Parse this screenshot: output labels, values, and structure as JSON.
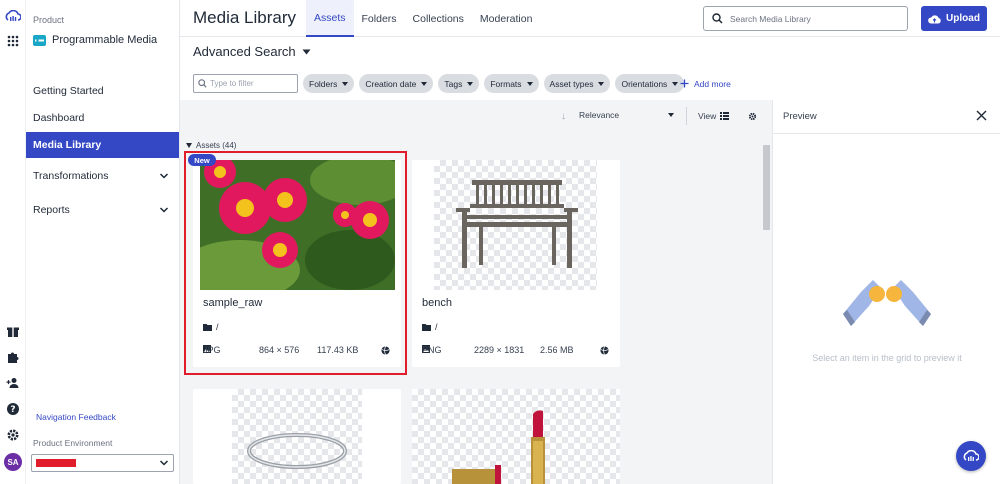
{
  "colors": {
    "accent": "#3448c5",
    "selection": "#e11d2b",
    "env_redacted": "#e11d2b",
    "avatar": "#6b2ea4"
  },
  "rail": {
    "icons": [
      "cloudinary-logo-icon",
      "apps-grid-icon",
      "gift-icon",
      "puzzle-icon",
      "user-add-icon",
      "help-icon",
      "gear-icon"
    ],
    "avatar_initials": "SA"
  },
  "sidebar": {
    "product_label": "Product",
    "product_name": "Programmable Media",
    "items": [
      {
        "label": "Getting Started",
        "active": false,
        "expandable": false
      },
      {
        "label": "Dashboard",
        "active": false,
        "expandable": false
      },
      {
        "label": "Media Library",
        "active": true,
        "expandable": false
      },
      {
        "label": "Transformations",
        "active": false,
        "expandable": true
      },
      {
        "label": "Reports",
        "active": false,
        "expandable": true
      }
    ],
    "feedback_link": "Navigation Feedback",
    "env_label": "Product Environment"
  },
  "header": {
    "title": "Media Library",
    "tabs": [
      {
        "label": "Assets",
        "active": true
      },
      {
        "label": "Folders",
        "active": false
      },
      {
        "label": "Collections",
        "active": false
      },
      {
        "label": "Moderation",
        "active": false
      }
    ],
    "search_placeholder": "Search Media Library",
    "upload_label": "Upload"
  },
  "filters": {
    "advanced_search_label": "Advanced Search",
    "filter_placeholder": "Type to filter",
    "chips": [
      "Folders",
      "Creation date",
      "Tags",
      "Formats",
      "Asset types",
      "Orientations"
    ],
    "add_more": "Add more"
  },
  "grid": {
    "sort_label": "Relevance",
    "view_label": "View",
    "assets_header": "Assets (44)",
    "badge_new": "New",
    "cards": [
      {
        "name": "sample_raw",
        "folder": "/",
        "format": "JPG",
        "dimensions": "864 × 576",
        "size": "117.43 KB",
        "selected": true,
        "thumb": "flowers"
      },
      {
        "name": "bench",
        "folder": "/",
        "format": "PNG",
        "dimensions": "2289 × 1831",
        "size": "2.56 MB",
        "selected": false,
        "thumb": "bench"
      },
      {
        "name": "",
        "thumb": "bracelet"
      },
      {
        "name": "",
        "thumb": "lipstick"
      }
    ]
  },
  "preview": {
    "title": "Preview",
    "empty_text": "Select an item in the grid to preview it"
  }
}
